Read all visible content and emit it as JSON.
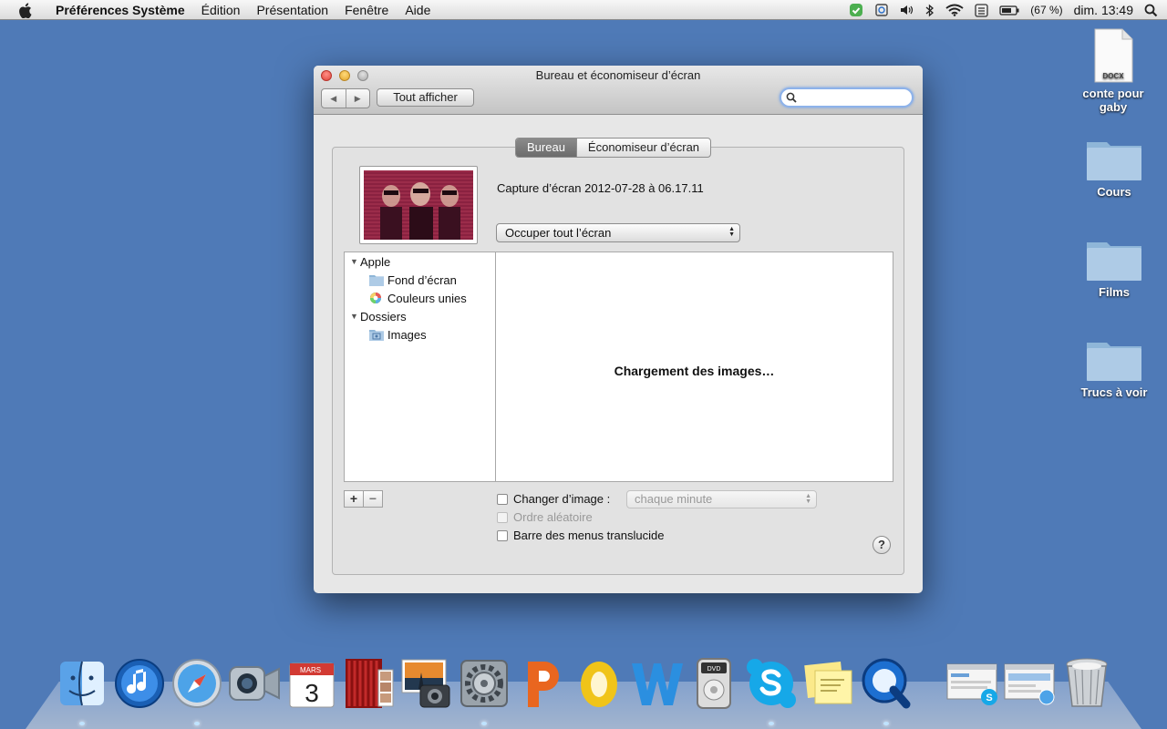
{
  "menubar": {
    "app_name": "Préférences Système",
    "items": [
      "Édition",
      "Présentation",
      "Fenêtre",
      "Aide"
    ],
    "battery": "(67 %)",
    "clock": "dim. 13:49"
  },
  "desktop": {
    "icons": [
      {
        "label": "conte pour gaby",
        "badge": "DOCX",
        "type": "document"
      },
      {
        "label": "Cours",
        "type": "folder"
      },
      {
        "label": "Films",
        "type": "folder"
      },
      {
        "label": "Trucs à voir",
        "type": "folder"
      }
    ]
  },
  "window": {
    "title": "Bureau et économiseur d’écran",
    "show_all": "Tout afficher",
    "search": {
      "value": "",
      "placeholder": ""
    },
    "tabs": [
      {
        "label": "Bureau",
        "active": true
      },
      {
        "label": "Économiseur d’écran",
        "active": false
      }
    ],
    "current_picture": "Capture d’écran 2012-07-28 à 06.17.11",
    "fill_mode": "Occuper tout l’écran",
    "sources": {
      "apple_group": "Apple",
      "apple_items": [
        "Fond d’écran",
        "Couleurs unies"
      ],
      "folders_group": "Dossiers",
      "folder_items": [
        "Images"
      ]
    },
    "loading": "Chargement des images…",
    "add": "+",
    "remove": "−",
    "change_picture": "Changer d’image :",
    "change_interval": "chaque minute",
    "random_order": "Ordre aléatoire",
    "translucent_menu": "Barre des menus translucide",
    "help": "?"
  },
  "dock": {
    "items": [
      "finder",
      "itunes",
      "safari",
      "facetime",
      "calendar",
      "photo-booth",
      "iphoto",
      "system-preferences",
      "powerpoint",
      "outlook",
      "word",
      "dvd-player",
      "skype",
      "stickies",
      "quicktime",
      "skype-window",
      "safari-window",
      "trash"
    ],
    "calendar_month": "MARS",
    "calendar_day": "3",
    "dvd_label": "DVD"
  },
  "colors": {
    "desktop": "#4f7ab7",
    "window_bg": "#e7e7e7",
    "tab_active": "#7a7a7a"
  }
}
